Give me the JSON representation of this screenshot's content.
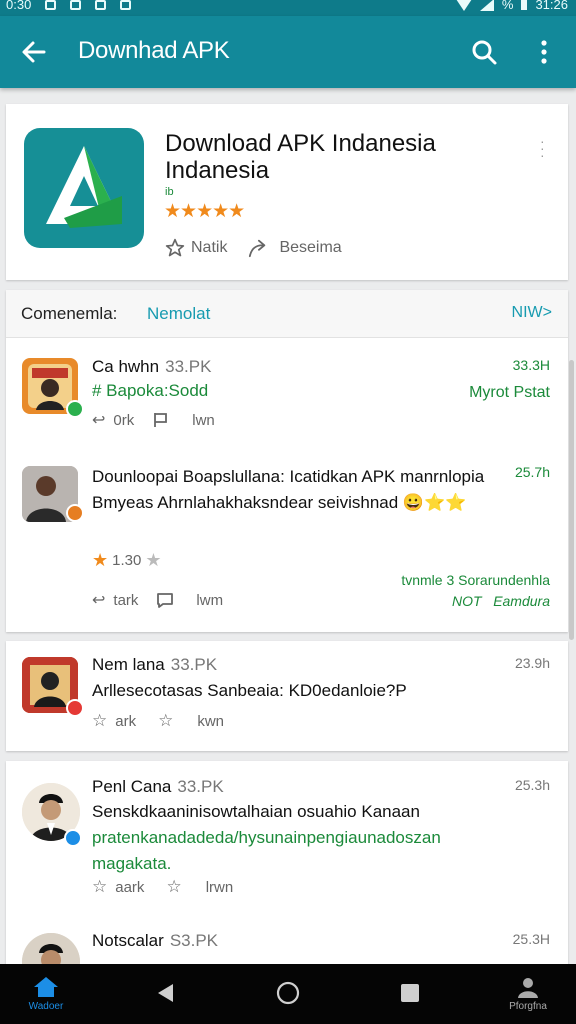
{
  "status": {
    "time": "0:30",
    "battery_time": "31:26",
    "signal": "%"
  },
  "appbar": {
    "title": "Downhad APK"
  },
  "app": {
    "name_line1": "Download APK Indanesia",
    "name_line2": "Indanesia",
    "tag": "ib",
    "stars": "★★★★★",
    "action1": "Natik",
    "action2": "Beseima"
  },
  "comments_header": {
    "label": "Comenemla:",
    "filter": "Nemolat",
    "new": "NIW>"
  },
  "comments": [
    {
      "name": "Ca hwhn",
      "size": "33.PK",
      "time": "33.3H",
      "text": "# Bapoka:Sodd",
      "right": "Myrot Pstat",
      "a1": "0rk",
      "a2": "lwn"
    },
    {
      "name": "",
      "size": "",
      "time": "25.7h",
      "text": "Dounloopai Boapslullana: Icatidkan APK manrnlopia Bmyeas Ahrnlahakhaksndear seivishnad 😀⭐⭐",
      "rating": "1.30",
      "right1": "tvnmle 3 Sorarundenhla",
      "right2": "NOT",
      "right3": "Eamdura",
      "a1": "tark",
      "a2": "lwm"
    },
    {
      "name": "Nem lana",
      "size": "33.PK",
      "time": "23.9h",
      "text": "Arllesecotasas Sanbeaia: KD0edanloie?P",
      "a1": "ark",
      "a2": "kwn"
    },
    {
      "name": "Penl Cana",
      "size": "33.PK",
      "time": "25.3h",
      "text1": "Senskdkaaninisowtalhaian osuahio Kanaan",
      "text2": "pratenkanadadeda/hysunainpengiaunadoszan",
      "text3": "magakata.",
      "a1": "aark",
      "a2": "lrwn"
    },
    {
      "name": "Notscalar",
      "size": "S3.PK",
      "time": "25.3H"
    }
  ],
  "nav": {
    "home": "Wadoer",
    "profile": "Pforgfna"
  }
}
